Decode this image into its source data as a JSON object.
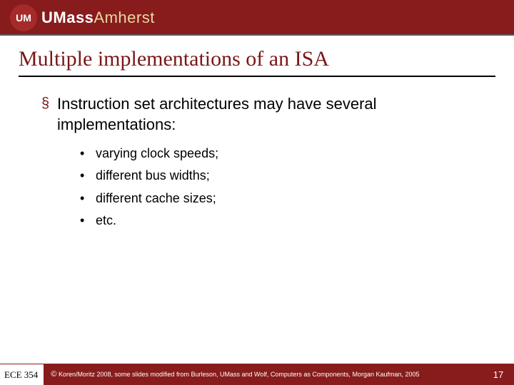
{
  "header": {
    "logo_letters": "UM",
    "wordmark_left": "UMass",
    "wordmark_right": "Amherst"
  },
  "title": "Multiple implementations of an ISA",
  "bullets": {
    "l1_marker": "§",
    "l1_text": "Instruction set architectures may have several implementations:",
    "l2_marker": "•",
    "items": [
      "varying clock speeds;",
      "different bus widths;",
      "different cache sizes;",
      "etc."
    ]
  },
  "footer": {
    "course": "ECE 354",
    "copy_symbol": "©",
    "credits": "Koren/Moritz 2008,  some slides modified from Burleson, UMass and Wolf, Computers as Components, Morgan Kaufman, 2005",
    "page": "17"
  }
}
